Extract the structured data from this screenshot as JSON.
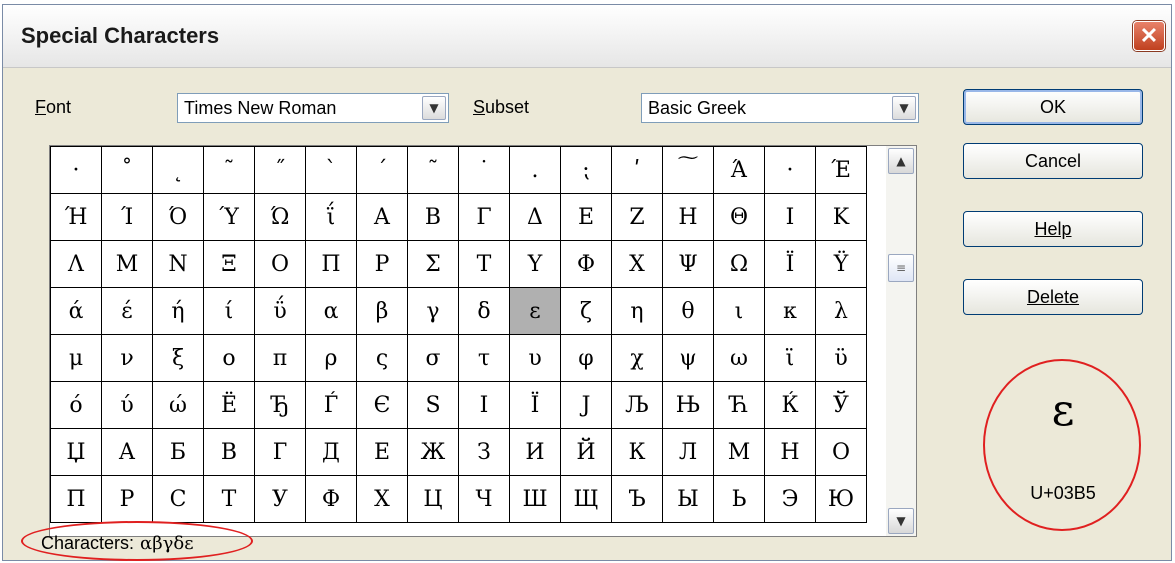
{
  "dialog": {
    "title": "Special Characters",
    "close_glyph": "✕"
  },
  "font": {
    "label_prefix": "",
    "label_accel": "F",
    "label_rest": "ont",
    "value": "Times New Roman"
  },
  "subset": {
    "label_accel": "S",
    "label_rest": "ubset",
    "value": "Basic Greek"
  },
  "buttons": {
    "ok": "OK",
    "cancel": "Cancel",
    "help": "Help",
    "delete": "Delete"
  },
  "grid": {
    "selected": [
      3,
      9
    ],
    "rows": [
      [
        "·",
        "˚",
        "˛",
        "˜",
        "˝",
        "ˋ",
        "ˊ",
        "˜",
        "˙",
        ".",
        "⁏",
        "ʹ",
        "͠",
        "Ά",
        "·",
        "Έ"
      ],
      [
        "Ή",
        "Ί",
        "Ό",
        "Ύ",
        "Ώ",
        "ΐ",
        "Α",
        "Β",
        "Γ",
        "Δ",
        "Ε",
        "Ζ",
        "Η",
        "Θ",
        "Ι",
        "Κ"
      ],
      [
        "Λ",
        "Μ",
        "Ν",
        "Ξ",
        "Ο",
        "Π",
        "Ρ",
        "Σ",
        "Τ",
        "Υ",
        "Φ",
        "Χ",
        "Ψ",
        "Ω",
        "Ϊ",
        "Ϋ"
      ],
      [
        "ά",
        "έ",
        "ή",
        "ί",
        "ΰ",
        "α",
        "β",
        "γ",
        "δ",
        "ε",
        "ζ",
        "η",
        "θ",
        "ι",
        "κ",
        "λ"
      ],
      [
        "μ",
        "ν",
        "ξ",
        "ο",
        "π",
        "ρ",
        "ς",
        "σ",
        "τ",
        "υ",
        "φ",
        "χ",
        "ψ",
        "ω",
        "ϊ",
        "ϋ"
      ],
      [
        "ό",
        "ύ",
        "ώ",
        "Ë",
        "Ђ",
        "Ѓ",
        "Є",
        "S",
        "I",
        "Ï",
        "J",
        "Љ",
        "Њ",
        "Ћ",
        "Ќ",
        "Ў"
      ],
      [
        "Џ",
        "А",
        "Б",
        "В",
        "Г",
        "Д",
        "Е",
        "Ж",
        "З",
        "И",
        "Й",
        "К",
        "Л",
        "М",
        "Н",
        "О"
      ],
      [
        "П",
        "Р",
        "С",
        "Т",
        "У",
        "Ф",
        "Х",
        "Ц",
        "Ч",
        "Ш",
        "Щ",
        "Ъ",
        "Ы",
        "Ь",
        "Э",
        "Ю"
      ]
    ]
  },
  "scrollbar": {
    "up_icon": "arrow-up-icon",
    "down_icon": "arrow-down-icon",
    "thumb_grip": "≡"
  },
  "preview": {
    "char": "ε",
    "code": "U+03B5"
  },
  "characters": {
    "label": "Characters:",
    "value": "αβγδε"
  },
  "colors": {
    "annotation_ellipse": "#e02020",
    "selected_cell": "#b0b0b0"
  }
}
